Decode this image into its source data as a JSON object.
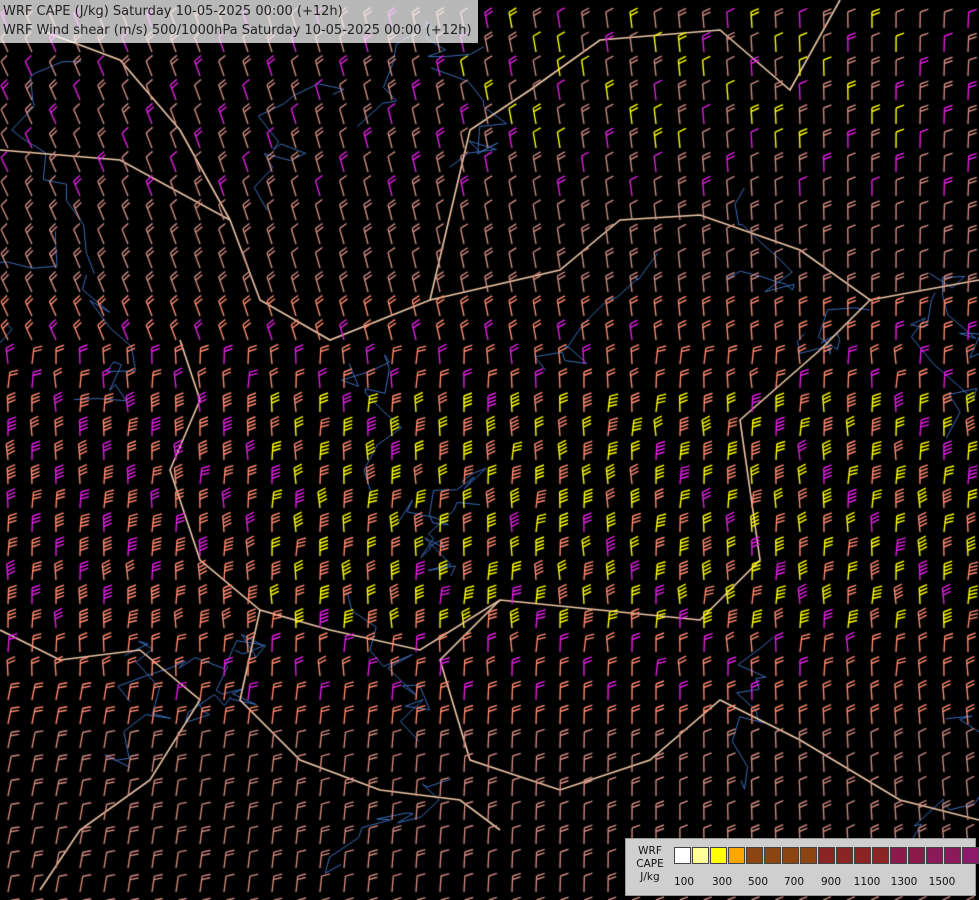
{
  "title": {
    "line1": "WRF CAPE (J/kg) Saturday 10-05-2025 00:00 (+12h)",
    "line2": "WRF Wind shear (m/s) 500/1000hPa Saturday 10-05-2025 00:00 (+12h)"
  },
  "legend": {
    "name_lines": [
      "WRF",
      "CAPE",
      "J/kg"
    ],
    "swatch_colors": [
      "#ffffff",
      "#ffff99",
      "#ffff00",
      "#ffa500",
      "#8b4513",
      "#8b4513",
      "#8b4513",
      "#8b4513",
      "#8b2525",
      "#8b2525",
      "#8b2525",
      "#8b2525",
      "#8b1a4a",
      "#8b1a4a",
      "#8b1a5a",
      "#8b1a5a",
      "#8b1a6a",
      "#8b1a6a"
    ],
    "tick_labels": [
      "100",
      "300",
      "500",
      "700",
      "900",
      "1100",
      "1300",
      "1500"
    ]
  },
  "colors": {
    "background": "#000000",
    "borders": "#f0c8a8",
    "rivers": "#3a6bb8",
    "barb_low": "#d08a80",
    "barb_mid": "#ff8a70",
    "barb_high": "#e020e0",
    "barb_max": "#ffff00"
  }
}
